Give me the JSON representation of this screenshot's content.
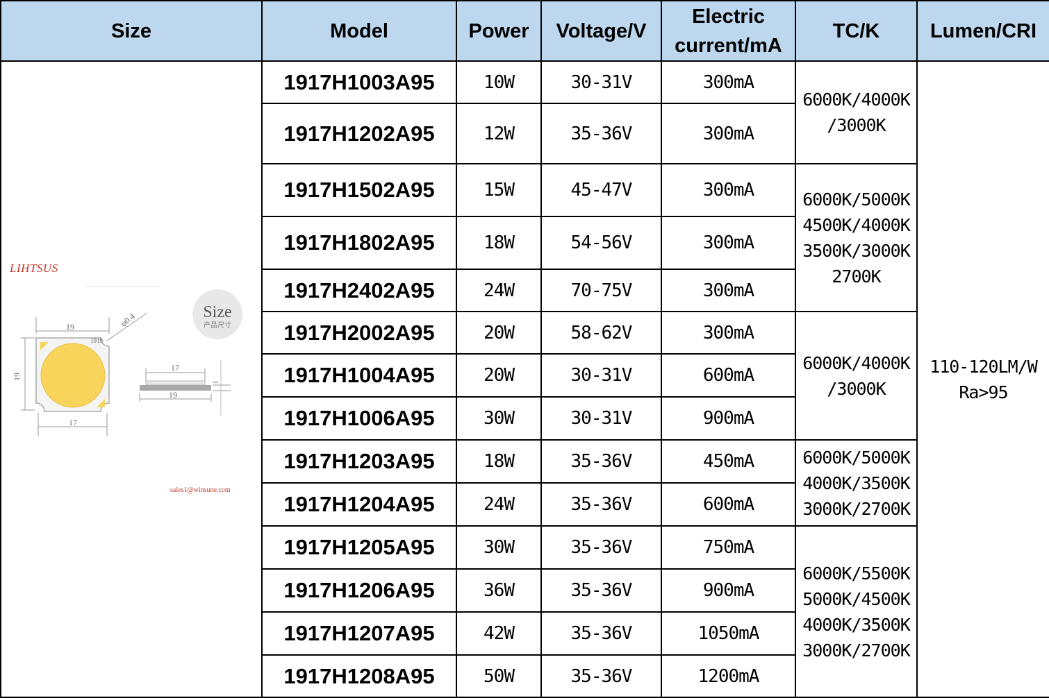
{
  "headers": {
    "size": "Size",
    "model": "Model",
    "power": "Power",
    "voltage": "Voltage/V",
    "current_line1": "Electric",
    "current_line2": "current/mA",
    "tc": "TC/K",
    "lumen": "Lumen/CRI"
  },
  "size_figure": {
    "brand": "LIHTSUS",
    "badge_title": "Size",
    "badge_subtitle": "产品尺寸",
    "dim_top": "19",
    "dim_left": "19",
    "dim_bottom": "17",
    "chip_label": "1919",
    "hole_label": "φ0.4",
    "side_width_top": "17",
    "side_width_bottom": "19",
    "side_thickness": "1",
    "email": "sales1@winsune.com"
  },
  "rows": [
    {
      "model": "1917H1003A95",
      "power": "10W",
      "voltage": "30-31V",
      "current": "300mA"
    },
    {
      "model": "1917H1202A95",
      "power": "12W",
      "voltage": "35-36V",
      "current": "300mA"
    },
    {
      "model": "1917H1502A95",
      "power": "15W",
      "voltage": "45-47V",
      "current": "300mA"
    },
    {
      "model": "1917H1802A95",
      "power": "18W",
      "voltage": "54-56V",
      "current": "300mA"
    },
    {
      "model": "1917H2402A95",
      "power": "24W",
      "voltage": "70-75V",
      "current": "300mA"
    },
    {
      "model": "1917H2002A95",
      "power": "20W",
      "voltage": "58-62V",
      "current": "300mA"
    },
    {
      "model": "1917H1004A95",
      "power": "20W",
      "voltage": "30-31V",
      "current": "600mA"
    },
    {
      "model": "1917H1006A95",
      "power": "30W",
      "voltage": "30-31V",
      "current": "900mA"
    },
    {
      "model": "1917H1203A95",
      "power": "18W",
      "voltage": "35-36V",
      "current": "450mA"
    },
    {
      "model": "1917H1204A95",
      "power": "24W",
      "voltage": "35-36V",
      "current": "600mA"
    },
    {
      "model": "1917H1205A95",
      "power": "30W",
      "voltage": "35-36V",
      "current": "750mA"
    },
    {
      "model": "1917H1206A95",
      "power": "36W",
      "voltage": "35-36V",
      "current": "900mA"
    },
    {
      "model": "1917H1207A95",
      "power": "42W",
      "voltage": "35-36V",
      "current": "1050mA"
    },
    {
      "model": "1917H1208A95",
      "power": "50W",
      "voltage": "35-36V",
      "current": "1200mA"
    }
  ],
  "tc_groups": [
    {
      "lines": [
        "6000K/4000K",
        "/3000K"
      ]
    },
    {
      "lines": [
        "6000K/5000K",
        "4500K/4000K",
        "3500K/3000K",
        "2700K"
      ]
    },
    {
      "lines": [
        "6000K/4000K",
        "/3000K"
      ]
    },
    {
      "lines": [
        "6000K/5000K",
        "4000K/3500K",
        "3000K/2700K"
      ]
    },
    {
      "lines": [
        "6000K/5500K",
        "5000K/4500K",
        "4000K/3500K",
        "3000K/2700K"
      ]
    }
  ],
  "lumen": {
    "line1": "110-120LM/W",
    "line2": "Ra>95"
  }
}
